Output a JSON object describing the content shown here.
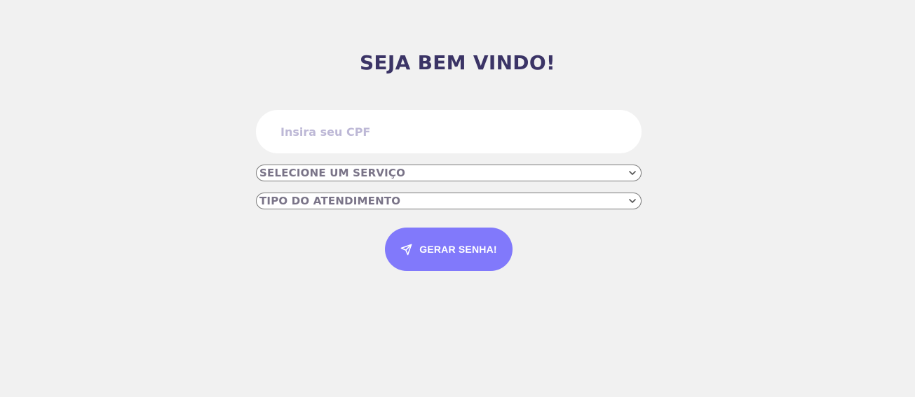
{
  "header": {
    "title": "SEJA BEM VINDO!"
  },
  "form": {
    "cpf_placeholder": "Insira seu CPF",
    "cpf_value": "",
    "service_select": {
      "selected": "SELECIONE UM SERVIÇO"
    },
    "type_select": {
      "selected": "TIPO DO ATENDIMENTO"
    },
    "submit": {
      "label": "GERAR SENHA!",
      "icon": "paper-plane-icon"
    }
  },
  "colors": {
    "background": "#f1f1f1",
    "title": "#3b3466",
    "placeholder": "#bdb8d6",
    "button": "#8179fb",
    "select_text": "#7a7488"
  }
}
